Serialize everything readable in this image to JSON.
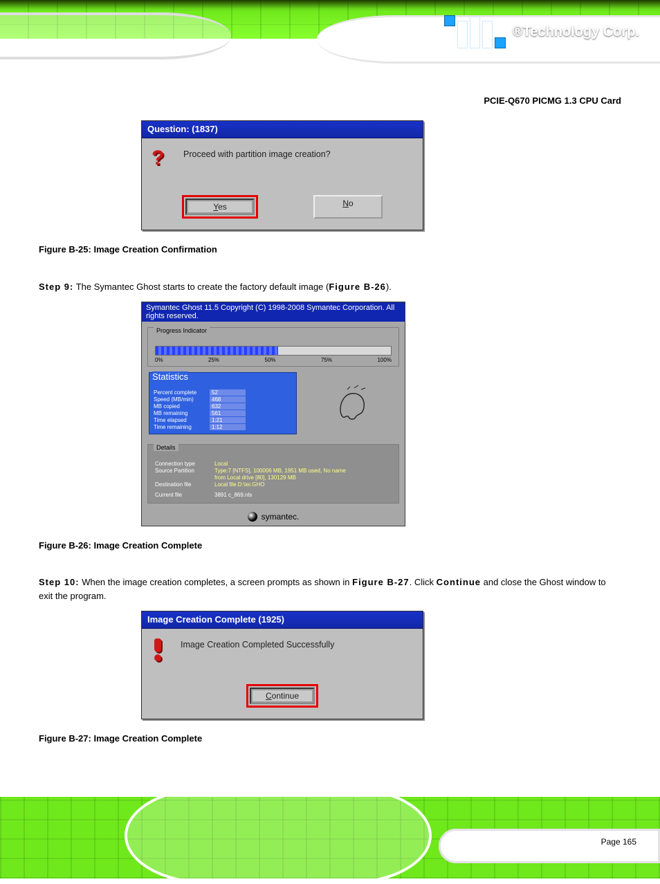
{
  "header": {
    "brand_reg": "®",
    "brand_text": "Technology Corp."
  },
  "top_right_line": "PCIE-Q670 PICMG 1.3 CPU Card",
  "steps": {
    "s9": {
      "label": "Step 9:",
      "text_before": " The Symantec Ghost starts to create the factory default image (",
      "fig_ref": "Figure B-26",
      "text_after": ")."
    },
    "s10": {
      "label": "Step 10:",
      "text_before": " When the image creation completes, a screen prompts as shown in ",
      "fig_ref": "Figure B-27",
      "text_after_ref": ".",
      "text_click": " Click ",
      "btn": "Continue",
      "text_tail": " and close the Ghost window to exit the program."
    }
  },
  "dlg1": {
    "title": "Question: (1837)",
    "message": "Proceed with partition image creation?",
    "yes": "Yes",
    "no": "No"
  },
  "cap1": "Figure B-25: Image Creation Confirmation",
  "ghost": {
    "titlebar": "Symantec Ghost 11.5   Copyright (C) 1998-2008 Symantec Corporation. All rights reserved.",
    "progress_label": "Progress Indicator",
    "ticks": {
      "t0": "0%",
      "t25": "25%",
      "t50": "50%",
      "t75": "75%",
      "t100": "100%"
    },
    "fill_pct": 52,
    "stats_label": "Statistics",
    "stats": {
      "percent": {
        "k": "Percent complete",
        "v": "52"
      },
      "speed": {
        "k": "Speed (MB/min)",
        "v": "468"
      },
      "copied": {
        "k": "MB copied",
        "v": "632"
      },
      "remain": {
        "k": "MB remaining",
        "v": "561"
      },
      "elapsed": {
        "k": "Time elapsed",
        "v": "1:21"
      },
      "left": {
        "k": "Time remaining",
        "v": "1:12"
      }
    },
    "details_label": "Details",
    "details": {
      "conn": {
        "k": "Connection type",
        "v": "Local"
      },
      "src1": {
        "k": "Source Partition",
        "v": "Type:7 [NTFS], 100006 MB, 1951 MB used, No name"
      },
      "src2": {
        "k": "",
        "v": "from Local drive [80], 130129 MB"
      },
      "dest": {
        "k": "Destination file",
        "v": "Local file D:\\iei.GHO"
      },
      "cur": {
        "k": "Current file",
        "v": "3891 c_869.nls"
      }
    },
    "brand": "symantec."
  },
  "cap2": "Figure B-26: Image Creation Complete",
  "dlg3": {
    "title": "Image Creation Complete (1925)",
    "message": "Image Creation Completed Successfully",
    "continue": "Continue"
  },
  "cap3": "Figure B-27: Image Creation Complete",
  "footer": {
    "page": "Page 165"
  }
}
